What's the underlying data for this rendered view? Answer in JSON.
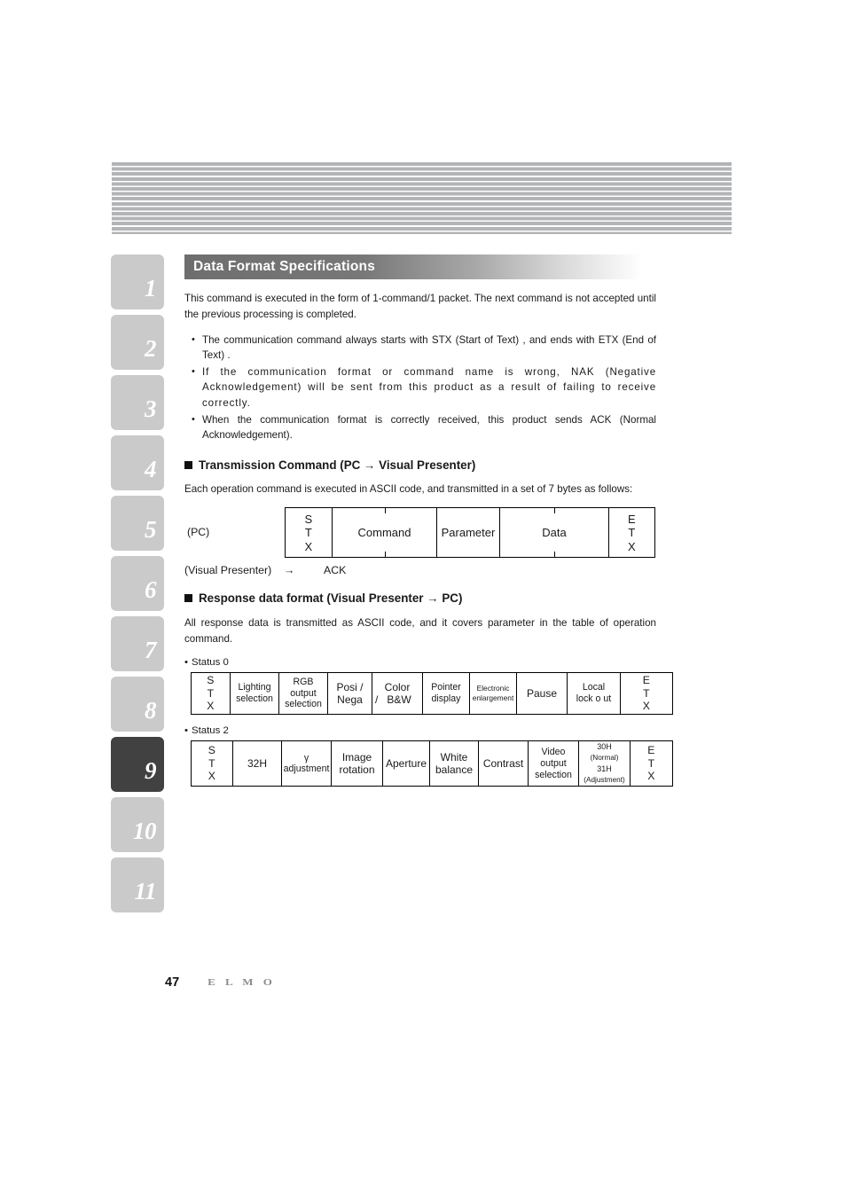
{
  "section": {
    "title": "Data Format Specifications"
  },
  "tabs": [
    {
      "label": "1",
      "active": false
    },
    {
      "label": "2",
      "active": false
    },
    {
      "label": "3",
      "active": false
    },
    {
      "label": "4",
      "active": false
    },
    {
      "label": "5",
      "active": false
    },
    {
      "label": "6",
      "active": false
    },
    {
      "label": "7",
      "active": false
    },
    {
      "label": "8",
      "active": false
    },
    {
      "label": "9",
      "active": true
    },
    {
      "label": "10",
      "active": false
    },
    {
      "label": "11",
      "active": false
    }
  ],
  "intro": {
    "paragraph": "This command is executed in the form of 1-command/1 packet.  The next command is not accepted until the previous processing is completed.",
    "bullets": [
      "The communication command always starts with STX (Start of Text) , and ends with ETX (End of Text) .",
      "If the communication format or command name is wrong, NAK (Negative Acknowledgement) will be sent from this product as a result of failing to receive correctly.",
      "When the communication format is correctly received, this product sends ACK (Normal Acknowledgement)."
    ]
  },
  "transmission": {
    "heading": "Transmission Command (PC → Visual Presenter)",
    "description": "Each operation command is executed in ASCII code, and transmitted in a set of 7 bytes as follows:",
    "pc_label": "(PC)",
    "cells": [
      {
        "text": "S\nT\nX",
        "type": "stx"
      },
      {
        "text": "Command",
        "type": "ticked"
      },
      {
        "text": "Parameter",
        "type": "plain"
      },
      {
        "text": "Data",
        "type": "ticked"
      },
      {
        "text": "E\nT\nX",
        "type": "stx"
      }
    ],
    "response_label": "(Visual Presenter)",
    "response_arrow": "→",
    "response_value": "ACK"
  },
  "response_format": {
    "heading": "Response data format (Visual Presenter → PC)",
    "description": "All response data is transmitted as ASCII code, and it covers parameter in the table of operation command.",
    "status0": {
      "label": "Status 0",
      "cells": [
        {
          "lines": [
            "S",
            "T",
            "X"
          ],
          "style": "stx"
        },
        {
          "lines": [
            "Lighting",
            "selection"
          ],
          "style": "normal"
        },
        {
          "lines": [
            "RGB",
            "output",
            "selection"
          ],
          "style": "normal"
        },
        {
          "lines": [
            "Posi /",
            "Nega"
          ],
          "style": "big"
        },
        {
          "lines": [
            "Color",
            "/     B&W"
          ],
          "style": "colorbw"
        },
        {
          "lines": [
            "Pointer",
            "display"
          ],
          "style": "normal"
        },
        {
          "lines": [
            "Electronic",
            "enlargement"
          ],
          "style": "tiny"
        },
        {
          "lines": [
            "Pause"
          ],
          "style": "big"
        },
        {
          "lines": [
            "Local",
            "lock o ut"
          ],
          "style": "normal"
        },
        {
          "lines": [
            "E",
            "T",
            "X"
          ],
          "style": "stx"
        }
      ]
    },
    "status2": {
      "label": "Status 2",
      "cells": [
        {
          "lines": [
            "S",
            "T",
            "X"
          ],
          "style": "stx"
        },
        {
          "lines": [
            "32H"
          ],
          "style": "big"
        },
        {
          "lines": [
            "γ",
            "adjustment"
          ],
          "style": "normal"
        },
        {
          "lines": [
            "Image",
            "rotation"
          ],
          "style": "normal"
        },
        {
          "lines": [
            "Aperture"
          ],
          "style": "normal"
        },
        {
          "lines": [
            "White",
            "balance"
          ],
          "style": "big"
        },
        {
          "lines": [
            "Contrast"
          ],
          "style": "big"
        },
        {
          "lines": [
            "Video",
            "output",
            "selection"
          ],
          "style": "normal"
        },
        {
          "lines": [
            "30H",
            "(Normal)",
            "31H",
            "(Adjustment)"
          ],
          "style": "small-sub"
        },
        {
          "lines": [
            "E",
            "T",
            "X"
          ],
          "style": "stx"
        }
      ]
    }
  },
  "footer": {
    "page_number": "47",
    "logo": "E L M O"
  },
  "colors": {
    "tab_inactive": "#cacaca",
    "tab_active": "#414141",
    "title_bar_dark": "#6e6e6e",
    "stripe_gray": "#b2b4b6",
    "logo_gray": "#8c8c8c"
  }
}
